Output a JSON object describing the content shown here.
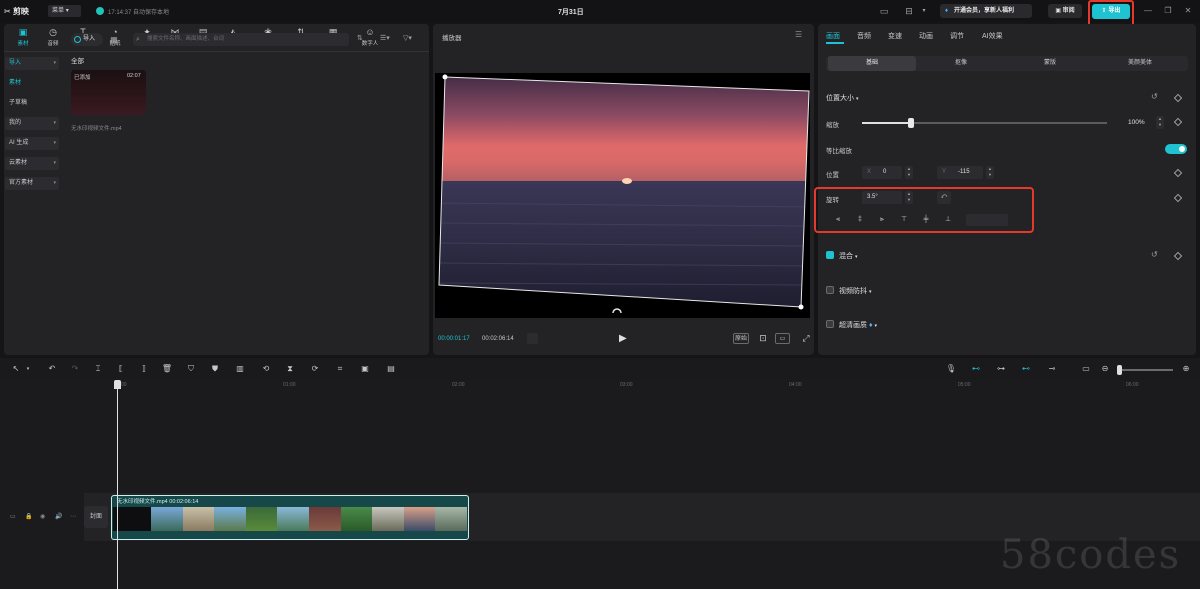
{
  "titlebar": {
    "logo": "剪映",
    "menu": "菜单",
    "autosave": "17:14:37 自动保存本地",
    "title": "7月31日",
    "vip": "开通会员，享新人福利",
    "review": "审阅",
    "export": "导出"
  },
  "media": {
    "tools": [
      {
        "label": "素材",
        "icon": "▣"
      },
      {
        "label": "音频",
        "icon": "◷"
      },
      {
        "label": "文本",
        "icon": "T"
      },
      {
        "label": "贴纸",
        "icon": "◔"
      },
      {
        "label": "特效",
        "icon": "✦"
      },
      {
        "label": "转场",
        "icon": "⋈"
      },
      {
        "label": "AI 字幕",
        "icon": "▤"
      },
      {
        "label": "智能包装",
        "icon": "◭"
      },
      {
        "label": "滤镜",
        "icon": "❀"
      },
      {
        "label": "调节",
        "icon": "⇅"
      },
      {
        "label": "模板",
        "icon": "▦"
      },
      {
        "label": "数字人",
        "icon": "☺"
      }
    ],
    "sidebar": [
      "导入",
      "素材",
      "子草稿",
      "我的",
      "AI 生成",
      "云素材",
      "官方素材"
    ],
    "import_button": "导入",
    "search_placeholder": "搜索文件名称、画面描述、台词",
    "all_label": "全部",
    "thumb": {
      "added": "已添加",
      "duration": "02:07",
      "name": "无水印视频文件.mp4"
    }
  },
  "player": {
    "title": "播放器",
    "current": "00:00:01:17",
    "total": "00:02:06:14",
    "ratio": "原始"
  },
  "props": {
    "tabs": [
      "画面",
      "音频",
      "变速",
      "动画",
      "调节",
      "AI效果"
    ],
    "subtabs": [
      "基础",
      "抠像",
      "蒙版",
      "美颜美体"
    ],
    "position_size": "位置大小",
    "scale_label": "缩放",
    "scale_value": "100%",
    "uniform_scale": "等比缩放",
    "position_label": "位置",
    "pos_x_prefix": "X",
    "pos_x": "0",
    "pos_y_prefix": "Y",
    "pos_y": "-115",
    "rotate_label": "旋转",
    "rotate_value": "3.5°",
    "mix": "混合",
    "stabilize": "视频防抖",
    "superres": "超清画质",
    "scale_percent": 20
  },
  "timeline": {
    "ruler": [
      "00:00",
      "01:00",
      "02:00",
      "03:00",
      "04:00",
      "05:00",
      "06:00"
    ],
    "cover": "封面",
    "clip_name": "无水印视频文件.mp4",
    "clip_duration": "00:02:06:14"
  },
  "watermark": "58codes",
  "colors": {
    "accent": "#1fc2d1",
    "highlight": "#e4392d"
  }
}
